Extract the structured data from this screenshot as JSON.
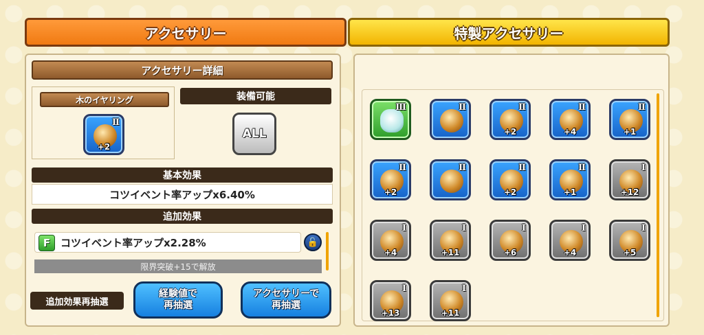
{
  "tabs": {
    "accessory": "アクセサリー",
    "special_accessory": "特製アクセサリー"
  },
  "detail": {
    "header": "アクセサリー詳細",
    "item_name": "木のイヤリング",
    "item_icon": {
      "name": "earring-icon",
      "rank": "Ⅱ",
      "plus": "+2"
    },
    "equippable_label": "装備可能",
    "equippable_value": "ALL",
    "base_effect_label": "基本効果",
    "base_effect_value": "コツイベント率アップx6.40%",
    "extra_effect_label": "追加効果",
    "extra_effect_grade": "F",
    "extra_effect_value": "コツイベント率アップx2.28%",
    "locked_text": "限界突破+15で解放"
  },
  "actions": {
    "reroll_label": "追加効果再抽選",
    "exp_reroll": "経験値で\n再抽選",
    "accessory_reroll": "アクセサリーで\n再抽選"
  },
  "grid_items": [
    {
      "name": "white-wolf-icon",
      "rank": "Ⅲ",
      "plus": "",
      "style": "green"
    },
    {
      "name": "mirror-pendant-icon",
      "rank": "Ⅱ",
      "plus": "",
      "style": "blue"
    },
    {
      "name": "earring-icon",
      "rank": "Ⅱ",
      "plus": "+2",
      "style": "blue"
    },
    {
      "name": "bracelet-icon",
      "rank": "Ⅱ",
      "plus": "+4",
      "style": "blue"
    },
    {
      "name": "necklace-icon",
      "rank": "Ⅱ",
      "plus": "+1",
      "style": "blue"
    },
    {
      "name": "necklace-icon",
      "rank": "Ⅱ",
      "plus": "+2",
      "style": "blue"
    },
    {
      "name": "ring-icon",
      "rank": "Ⅱ",
      "plus": "",
      "style": "blue"
    },
    {
      "name": "leaf-icon",
      "rank": "Ⅱ",
      "plus": "+2",
      "style": "blue"
    },
    {
      "name": "gray-wolf-icon",
      "rank": "Ⅱ",
      "plus": "+1",
      "style": "blue"
    },
    {
      "name": "mirror-pendant-icon",
      "rank": "Ⅰ",
      "plus": "+12",
      "style": "gray"
    },
    {
      "name": "earring-icon",
      "rank": "Ⅰ",
      "plus": "+4",
      "style": "gray"
    },
    {
      "name": "bracelet-icon",
      "rank": "Ⅰ",
      "plus": "+11",
      "style": "gray"
    },
    {
      "name": "tag-charm-icon",
      "rank": "Ⅰ",
      "plus": "+6",
      "style": "gray"
    },
    {
      "name": "necklace-icon",
      "rank": "Ⅰ",
      "plus": "+4",
      "style": "gray"
    },
    {
      "name": "ring-icon",
      "rank": "Ⅰ",
      "plus": "+5",
      "style": "gray"
    },
    {
      "name": "leaf-icon",
      "rank": "Ⅰ",
      "plus": "+13",
      "style": "gray"
    },
    {
      "name": "fox-icon",
      "rank": "Ⅰ",
      "plus": "+11",
      "style": "gray"
    }
  ]
}
